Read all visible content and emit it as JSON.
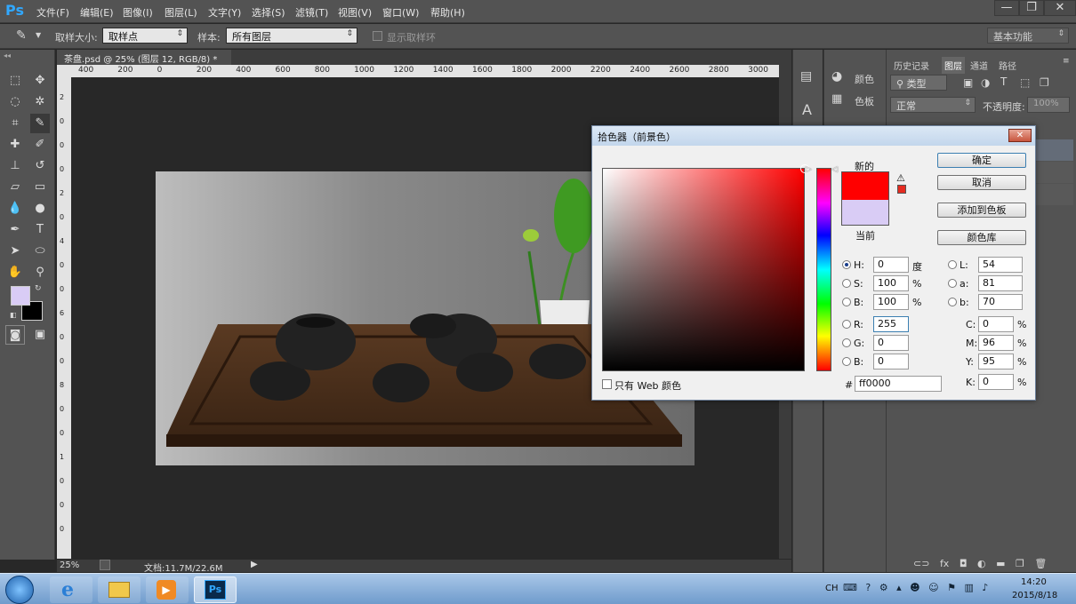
{
  "app": {
    "logo": "Ps"
  },
  "menu": [
    "文件(F)",
    "编辑(E)",
    "图像(I)",
    "图层(L)",
    "文字(Y)",
    "选择(S)",
    "滤镜(T)",
    "视图(V)",
    "窗口(W)",
    "帮助(H)"
  ],
  "options": {
    "sample_size_label": "取样大小:",
    "sample_size_value": "取样点",
    "sample_label": "样本:",
    "sample_value": "所有图层",
    "show_ring_label": "显示取样环",
    "workspace": "基本功能"
  },
  "document": {
    "tab_title": "茶盘.psd @ 25% (图层 12, RGB/8) *",
    "tab_close": "×"
  },
  "ruler": {
    "top": [
      "400",
      "200",
      "0",
      "200",
      "400",
      "600",
      "800",
      "1000",
      "1200",
      "1400",
      "1600",
      "1800",
      "2000",
      "2200",
      "2400",
      "2600",
      "2800",
      "3000"
    ],
    "left": [
      "2",
      "0",
      "0",
      "0",
      "2",
      "0",
      "4",
      "0",
      "0",
      "6",
      "0",
      "0",
      "8",
      "0",
      "0",
      "1",
      "0",
      "0",
      "0"
    ]
  },
  "status": {
    "zoom": "25%",
    "doc_info": "文档:11.7M/22.6M"
  },
  "panels": {
    "middle": {
      "color_label": "颜色",
      "swatches_label": "色板"
    },
    "layers": {
      "tabs": [
        "历史记录",
        "图层",
        "通道",
        "路径"
      ],
      "filter_kind": "类型",
      "blend_mode": "正常",
      "opacity_label": "不透明度:",
      "opacity_value": "100%"
    }
  },
  "color_picker": {
    "title": "拾色器（前景色）",
    "close": "✕",
    "new_label": "新的",
    "current_label": "当前",
    "new_color": "#ff0000",
    "current_color": "#d9ccf5",
    "buttons": {
      "ok": "确定",
      "cancel": "取消",
      "add_swatch": "添加到色板",
      "library": "颜色库"
    },
    "web_only_label": "只有 Web 颜色",
    "hsb": {
      "h": "0",
      "h_unit": "度",
      "s": "100",
      "s_unit": "%",
      "b": "100",
      "b_unit": "%"
    },
    "rgb": {
      "r": "255",
      "g": "0",
      "b": "0"
    },
    "lab": {
      "l": "54",
      "a": "81",
      "b": "70"
    },
    "cmyk": {
      "c": "0",
      "m": "96",
      "y": "95",
      "k": "0",
      "unit": "%"
    },
    "hex_label": "#",
    "hex": "ff0000",
    "field_labels": {
      "h": "H:",
      "s": "S:",
      "b": "B:",
      "r": "R:",
      "g": "G:",
      "bb": "B:",
      "l": "L:",
      "a": "a:",
      "lb": "b:",
      "c": "C:",
      "m": "M:",
      "y": "Y:",
      "k": "K:"
    }
  },
  "taskbar": {
    "ime": "CH",
    "time": "14:20",
    "date": "2015/8/18"
  }
}
